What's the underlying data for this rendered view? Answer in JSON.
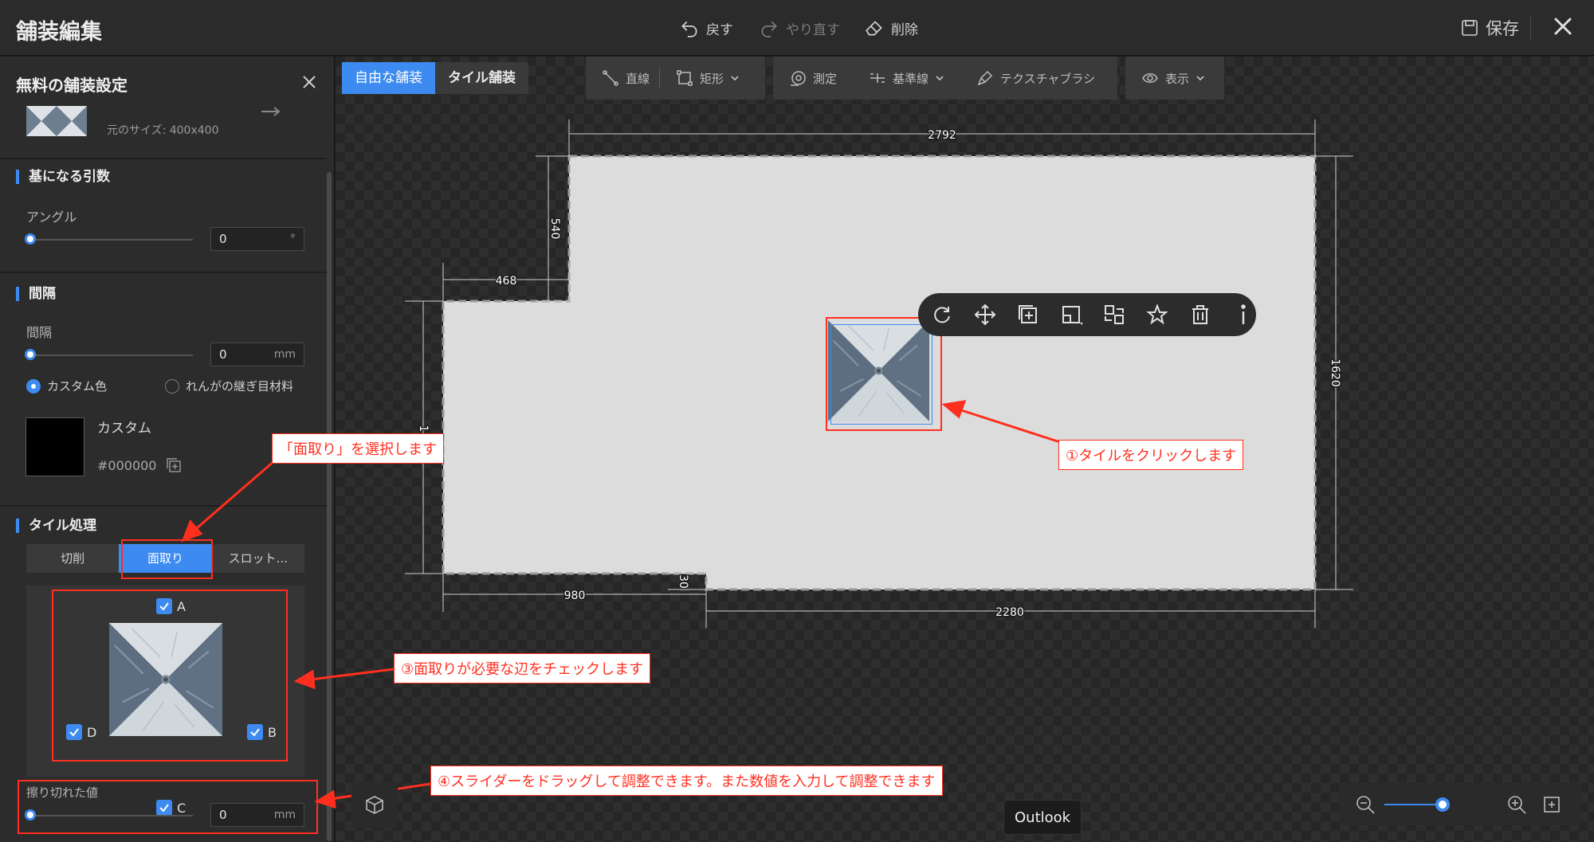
{
  "app": {
    "title": "舗装編集"
  },
  "history": {
    "undo": "戻す",
    "redo": "やり直す",
    "delete": "削除"
  },
  "save": {
    "label": "保存"
  },
  "panel": {
    "title": "無料の舗装設定",
    "orig_size": "元のサイズ: 400x400",
    "base": {
      "title": "基になる引数",
      "angle_label": "アングル",
      "angle_value": "0",
      "angle_unit": "°",
      "angle_slider": 0
    },
    "spacing": {
      "title": "間隔",
      "label": "間隔",
      "value": "0",
      "unit": "mm",
      "slider": 0,
      "radio_custom": "カスタム色",
      "radio_brick": "れんがの継ぎ目材料",
      "custom_name": "カスタム",
      "hex": "#000000",
      "swatch_color": "#000000"
    },
    "tile_process": {
      "title": "タイル処理",
      "tabs": [
        "切削",
        "面取り",
        "スロット..."
      ],
      "active_tab": 1,
      "edges": {
        "a": "A",
        "b": "B",
        "c": "C",
        "d": "D"
      },
      "bevel_label": "擦り切れた値",
      "bevel_value": "0",
      "bevel_unit": "mm",
      "bevel_slider": 0
    }
  },
  "modes": [
    "自由な舗装",
    "タイル舗装"
  ],
  "tools": {
    "line": "直線",
    "rect": "矩形",
    "measure": "測定",
    "baseline": "基準線",
    "texture_brush": "テクスチャブラシ",
    "view": "表示"
  },
  "dimensions": {
    "top": "2792",
    "left_step": "540",
    "notch_width": "468",
    "right": "1620",
    "left_full": "1",
    "bottom_left": "980",
    "bottom_right": "2280",
    "bottom_step": "30"
  },
  "callouts": {
    "c1": "①タイルをクリックします",
    "c2": "「面取り」を選択します",
    "c3": "③面取りが必要な辺をチェックします",
    "c4": "④スライダーをドラッグして調整できます。また数値を入力して調整できます"
  },
  "tooltip": "Outlook",
  "zoom": {
    "level": 0.75
  },
  "colors": {
    "accent": "#3d8bf0",
    "annotation": "#ff2f1f",
    "floor": "#dcdcdc"
  },
  "icons": [
    "undo-icon",
    "redo-icon",
    "eraser-icon",
    "save-icon",
    "close-icon",
    "line-icon",
    "rect-icon",
    "measure-icon",
    "baseline-icon",
    "brush-icon",
    "eye-icon",
    "rotate-icon",
    "move-icon",
    "add-icon",
    "resize-icon",
    "replace-icon",
    "star-icon",
    "trash-icon",
    "info-icon",
    "cube-icon",
    "zoom-out-icon",
    "zoom-in-icon",
    "fit-icon"
  ]
}
